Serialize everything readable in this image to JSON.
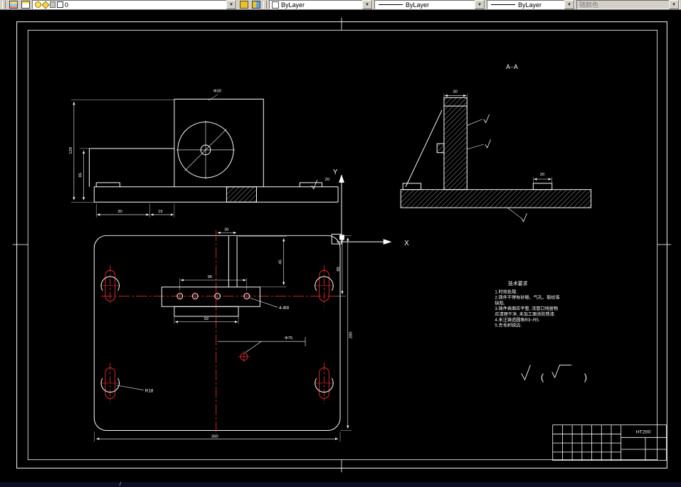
{
  "toolbar": {
    "layer_field": {
      "value": "0"
    },
    "color_field": {
      "value": "ByLayer"
    },
    "linetype_field": {
      "value": "ByLayer"
    },
    "lineweight_field": {
      "value": "ByLayer"
    },
    "plotstyle_field": {
      "value": "随颜色"
    },
    "dropdown_arrow": "▼"
  },
  "colors": {
    "toolbar_bg": "#d4d0c8",
    "canvas_bg": "#000000",
    "line_white": "#ffffff",
    "centerline_red": "#d92b2b",
    "statusbar_bg": "#0d0d26"
  },
  "drawing": {
    "section_title": "A-A",
    "ucs": {
      "x_label": "X",
      "y_label": "Y"
    },
    "notes": {
      "title": "技术要求",
      "lines": [
        "1.时效处理.",
        "2.铸件不得有砂眼、气孔、裂纹等",
        "  缺陷.",
        "3.铸件表面应平整, 浇冒口残留物",
        "  应清理干净, 未加工面涂防锈漆.",
        "4.未注铸造圆角R3~R5.",
        "5.去毛刺锐边."
      ]
    },
    "finish": {
      "paren_open": "(",
      "paren_close": ")"
    },
    "title_block": {
      "material": "HT200"
    },
    "dims": {
      "front_height_outer": "128",
      "front_height_inner": "85",
      "front_base_left": "30",
      "front_base_left2": "15",
      "front_top_dia": "Φ30",
      "front_right": "20",
      "section_col": "30",
      "section_boss": "20",
      "tv_feature_w": "96",
      "tv_inner_w": "92",
      "tv_holes": "4-Φ9",
      "tv_slot_r": "R18",
      "tv_height": "280",
      "tv_height_part": "85",
      "tv_width": "350",
      "tv_top": "30",
      "tv_slot_depth": "45",
      "tv_circle": "Φ75"
    }
  },
  "statusbar": {
    "mark": "/"
  }
}
